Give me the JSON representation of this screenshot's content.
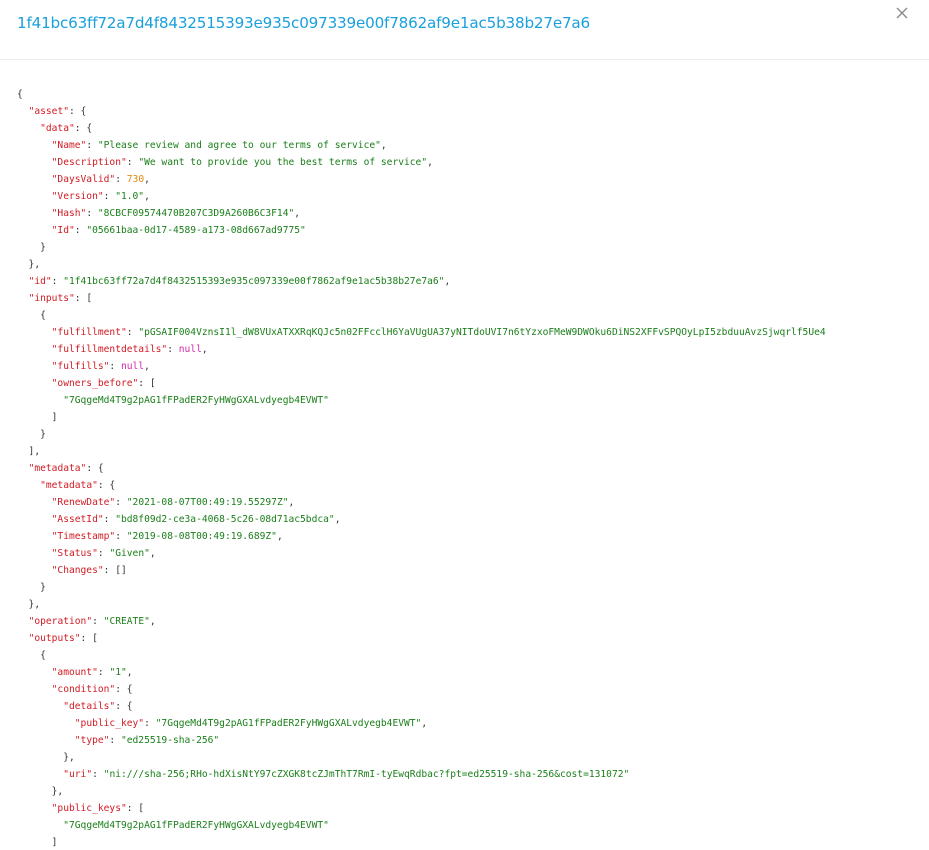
{
  "modal": {
    "title": "1f41bc63ff72a7d4f8432515393e935c097339e00f7862af9e1ac5b38b27e7a6",
    "close_icon": "close-icon"
  },
  "colors": {
    "title": "#1aa0dc",
    "key": "#d11b24",
    "string": "#1a7f1a",
    "number": "#e3880f",
    "null": "#d42aa8",
    "punctuation": "#333333"
  },
  "json_lines": [
    [
      [
        "p",
        "{"
      ]
    ],
    [
      [
        "p",
        "  "
      ],
      [
        "k",
        "\"asset\""
      ],
      [
        "p",
        ": {"
      ]
    ],
    [
      [
        "p",
        "    "
      ],
      [
        "k",
        "\"data\""
      ],
      [
        "p",
        ": {"
      ]
    ],
    [
      [
        "p",
        "      "
      ],
      [
        "k",
        "\"Name\""
      ],
      [
        "p",
        ": "
      ],
      [
        "s",
        "\"Please review and agree to our terms of service\""
      ],
      [
        "p",
        ","
      ]
    ],
    [
      [
        "p",
        "      "
      ],
      [
        "k",
        "\"Description\""
      ],
      [
        "p",
        ": "
      ],
      [
        "s",
        "\"We want to provide you the best terms of service\""
      ],
      [
        "p",
        ","
      ]
    ],
    [
      [
        "p",
        "      "
      ],
      [
        "k",
        "\"DaysValid\""
      ],
      [
        "p",
        ": "
      ],
      [
        "n",
        "730"
      ],
      [
        "p",
        ","
      ]
    ],
    [
      [
        "p",
        "      "
      ],
      [
        "k",
        "\"Version\""
      ],
      [
        "p",
        ": "
      ],
      [
        "s",
        "\"1.0\""
      ],
      [
        "p",
        ","
      ]
    ],
    [
      [
        "p",
        "      "
      ],
      [
        "k",
        "\"Hash\""
      ],
      [
        "p",
        ": "
      ],
      [
        "s",
        "\"8CBCF09574470B207C3D9A260B6C3F14\""
      ],
      [
        "p",
        ","
      ]
    ],
    [
      [
        "p",
        "      "
      ],
      [
        "k",
        "\"Id\""
      ],
      [
        "p",
        ": "
      ],
      [
        "s",
        "\"05661baa-0d17-4589-a173-08d667ad9775\""
      ]
    ],
    [
      [
        "p",
        "    }"
      ]
    ],
    [
      [
        "p",
        "  },"
      ]
    ],
    [
      [
        "p",
        "  "
      ],
      [
        "k",
        "\"id\""
      ],
      [
        "p",
        ": "
      ],
      [
        "s",
        "\"1f41bc63ff72a7d4f8432515393e935c097339e00f7862af9e1ac5b38b27e7a6\""
      ],
      [
        "p",
        ","
      ]
    ],
    [
      [
        "p",
        "  "
      ],
      [
        "k",
        "\"inputs\""
      ],
      [
        "p",
        ": ["
      ]
    ],
    [
      [
        "p",
        "    {"
      ]
    ],
    [
      [
        "p",
        "      "
      ],
      [
        "k",
        "\"fulfillment\""
      ],
      [
        "p",
        ": "
      ],
      [
        "s",
        "\"pGSAIF004VznsI1l_dW8VUxATXXRqKQJc5n02FFcclH6YaVUgUA37yNITdoUVI7n6tYzxoFMeW9DWOku6DiNS2XFFvSPQOyLpI5zbduuAvzSjwqrlf5Ue4"
      ]
    ],
    [
      [
        "p",
        "      "
      ],
      [
        "k",
        "\"fulfillmentdetails\""
      ],
      [
        "p",
        ": "
      ],
      [
        "u",
        "null"
      ],
      [
        "p",
        ","
      ]
    ],
    [
      [
        "p",
        "      "
      ],
      [
        "k",
        "\"fulfills\""
      ],
      [
        "p",
        ": "
      ],
      [
        "u",
        "null"
      ],
      [
        "p",
        ","
      ]
    ],
    [
      [
        "p",
        "      "
      ],
      [
        "k",
        "\"owners_before\""
      ],
      [
        "p",
        ": ["
      ]
    ],
    [
      [
        "p",
        "        "
      ],
      [
        "s",
        "\"7GqgeMd4T9g2pAG1fFPadER2FyHWgGXALvdyegb4EVWT\""
      ]
    ],
    [
      [
        "p",
        "      ]"
      ]
    ],
    [
      [
        "p",
        "    }"
      ]
    ],
    [
      [
        "p",
        "  ],"
      ]
    ],
    [
      [
        "p",
        "  "
      ],
      [
        "k",
        "\"metadata\""
      ],
      [
        "p",
        ": {"
      ]
    ],
    [
      [
        "p",
        "    "
      ],
      [
        "k",
        "\"metadata\""
      ],
      [
        "p",
        ": {"
      ]
    ],
    [
      [
        "p",
        "      "
      ],
      [
        "k",
        "\"RenewDate\""
      ],
      [
        "p",
        ": "
      ],
      [
        "s",
        "\"2021-08-07T00:49:19.55297Z\""
      ],
      [
        "p",
        ","
      ]
    ],
    [
      [
        "p",
        "      "
      ],
      [
        "k",
        "\"AssetId\""
      ],
      [
        "p",
        ": "
      ],
      [
        "s",
        "\"bd8f09d2-ce3a-4068-5c26-08d71ac5bdca\""
      ],
      [
        "p",
        ","
      ]
    ],
    [
      [
        "p",
        "      "
      ],
      [
        "k",
        "\"Timestamp\""
      ],
      [
        "p",
        ": "
      ],
      [
        "s",
        "\"2019-08-08T00:49:19.689Z\""
      ],
      [
        "p",
        ","
      ]
    ],
    [
      [
        "p",
        "      "
      ],
      [
        "k",
        "\"Status\""
      ],
      [
        "p",
        ": "
      ],
      [
        "s",
        "\"Given\""
      ],
      [
        "p",
        ","
      ]
    ],
    [
      [
        "p",
        "      "
      ],
      [
        "k",
        "\"Changes\""
      ],
      [
        "p",
        ": []"
      ]
    ],
    [
      [
        "p",
        "    }"
      ]
    ],
    [
      [
        "p",
        "  },"
      ]
    ],
    [
      [
        "p",
        "  "
      ],
      [
        "k",
        "\"operation\""
      ],
      [
        "p",
        ": "
      ],
      [
        "s",
        "\"CREATE\""
      ],
      [
        "p",
        ","
      ]
    ],
    [
      [
        "p",
        "  "
      ],
      [
        "k",
        "\"outputs\""
      ],
      [
        "p",
        ": ["
      ]
    ],
    [
      [
        "p",
        "    {"
      ]
    ],
    [
      [
        "p",
        "      "
      ],
      [
        "k",
        "\"amount\""
      ],
      [
        "p",
        ": "
      ],
      [
        "s",
        "\"1\""
      ],
      [
        "p",
        ","
      ]
    ],
    [
      [
        "p",
        "      "
      ],
      [
        "k",
        "\"condition\""
      ],
      [
        "p",
        ": {"
      ]
    ],
    [
      [
        "p",
        "        "
      ],
      [
        "k",
        "\"details\""
      ],
      [
        "p",
        ": {"
      ]
    ],
    [
      [
        "p",
        "          "
      ],
      [
        "k",
        "\"public_key\""
      ],
      [
        "p",
        ": "
      ],
      [
        "s",
        "\"7GqgeMd4T9g2pAG1fFPadER2FyHWgGXALvdyegb4EVWT\""
      ],
      [
        "p",
        ","
      ]
    ],
    [
      [
        "p",
        "          "
      ],
      [
        "k",
        "\"type\""
      ],
      [
        "p",
        ": "
      ],
      [
        "s",
        "\"ed25519-sha-256\""
      ]
    ],
    [
      [
        "p",
        "        },"
      ]
    ],
    [
      [
        "p",
        "        "
      ],
      [
        "k",
        "\"uri\""
      ],
      [
        "p",
        ": "
      ],
      [
        "s",
        "\"ni:///sha-256;RHo-hdXisNtY97cZXGK8tcZJmThT7RmI-tyEwqRdbac?fpt=ed25519-sha-256&cost=131072\""
      ]
    ],
    [
      [
        "p",
        "      },"
      ]
    ],
    [
      [
        "p",
        "      "
      ],
      [
        "k",
        "\"public_keys\""
      ],
      [
        "p",
        ": ["
      ]
    ],
    [
      [
        "p",
        "        "
      ],
      [
        "s",
        "\"7GqgeMd4T9g2pAG1fFPadER2FyHWgGXALvdyegb4EVWT\""
      ]
    ],
    [
      [
        "p",
        "      ]"
      ]
    ]
  ]
}
